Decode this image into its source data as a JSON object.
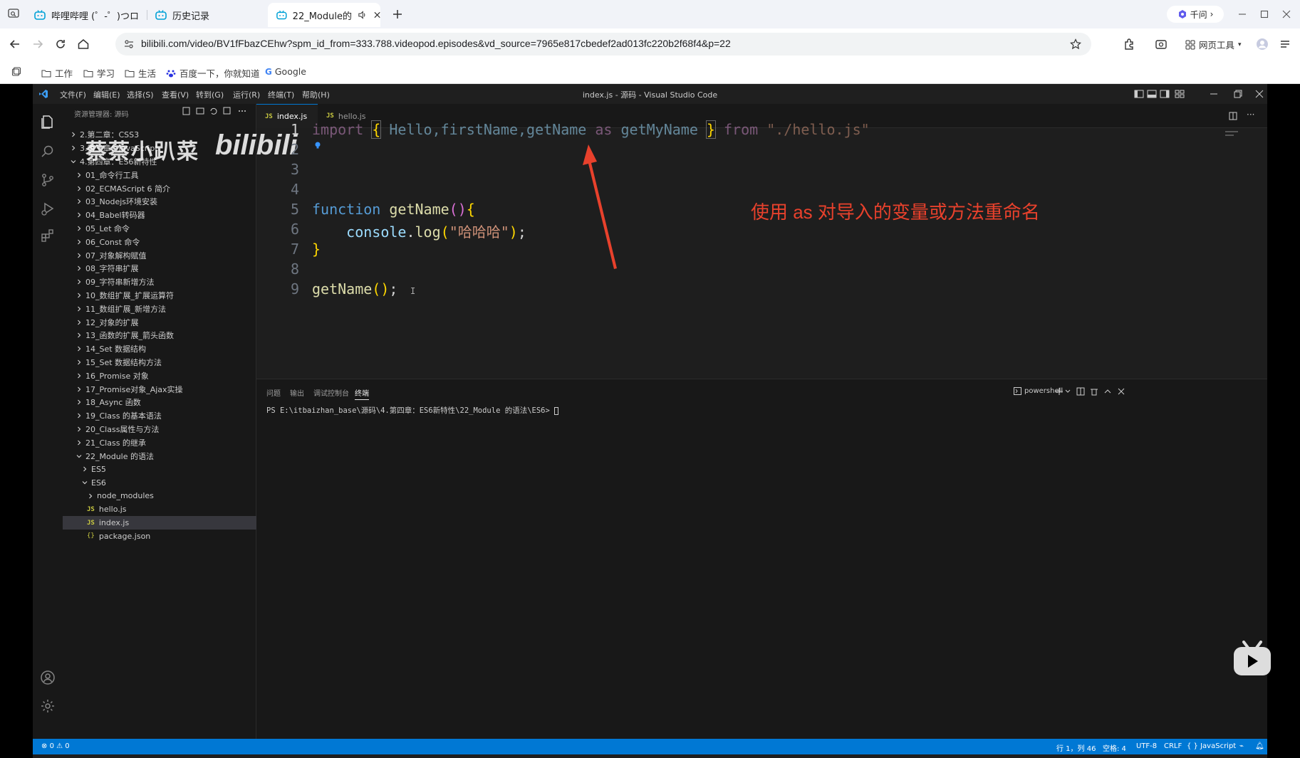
{
  "browser": {
    "tabs": [
      {
        "label": "哔哩哔哩 (゜-゜)つロ"
      },
      {
        "label": "历史记录"
      },
      {
        "label": "22_Module的"
      }
    ],
    "qianwen_label": "千问",
    "url": "bilibili.com/video/BV1fFbazCEhw?spm_id_from=333.788.videopod.episodes&vd_source=7965e817cbedef2ad013fc220b2f68f4&p=22",
    "web_tools_label": "网页工具",
    "bookmarks": [
      "工作",
      "学习",
      "生活",
      "百度一下，你就知道",
      "Google"
    ]
  },
  "vscode": {
    "menus": [
      "文件(F)",
      "编辑(E)",
      "选择(S)",
      "查看(V)",
      "转到(G)",
      "运行(R)",
      "终端(T)",
      "帮助(H)"
    ],
    "window_title": "index.js - 源码 - Visual Studio Code",
    "explorer_header": "资源管理器: 源码",
    "watermark": "蔡蔡小趴菜",
    "watermark_logo": "bilibili",
    "tree": [
      {
        "label": "2.第二章：CSS3",
        "indent": 1,
        "type": "folder",
        "open": false
      },
      {
        "label": "3.第三章：JavaScript",
        "indent": 1,
        "type": "folder",
        "open": false
      },
      {
        "label": "4.第四章：ES6新特性",
        "indent": 1,
        "type": "folder",
        "open": true
      },
      {
        "label": "01_命令行工具",
        "indent": 2,
        "type": "folder",
        "open": false
      },
      {
        "label": "02_ECMAScript 6 简介",
        "indent": 2,
        "type": "folder",
        "open": false
      },
      {
        "label": "03_Nodejs环境安装",
        "indent": 2,
        "type": "folder",
        "open": false
      },
      {
        "label": "04_Babel转码器",
        "indent": 2,
        "type": "folder",
        "open": false
      },
      {
        "label": "05_Let 命令",
        "indent": 2,
        "type": "folder",
        "open": false
      },
      {
        "label": "06_Const 命令",
        "indent": 2,
        "type": "folder",
        "open": false
      },
      {
        "label": "07_对象解构赋值",
        "indent": 2,
        "type": "folder",
        "open": false
      },
      {
        "label": "08_字符串扩展",
        "indent": 2,
        "type": "folder",
        "open": false
      },
      {
        "label": "09_字符串新增方法",
        "indent": 2,
        "type": "folder",
        "open": false
      },
      {
        "label": "10_数组扩展_扩展运算符",
        "indent": 2,
        "type": "folder",
        "open": false
      },
      {
        "label": "11_数组扩展_新增方法",
        "indent": 2,
        "type": "folder",
        "open": false
      },
      {
        "label": "12_对象的扩展",
        "indent": 2,
        "type": "folder",
        "open": false
      },
      {
        "label": "13_函数的扩展_箭头函数",
        "indent": 2,
        "type": "folder",
        "open": false
      },
      {
        "label": "14_Set 数据结构",
        "indent": 2,
        "type": "folder",
        "open": false
      },
      {
        "label": "15_Set 数据结构方法",
        "indent": 2,
        "type": "folder",
        "open": false
      },
      {
        "label": "16_Promise 对象",
        "indent": 2,
        "type": "folder",
        "open": false
      },
      {
        "label": "17_Promise对象_Ajax实操",
        "indent": 2,
        "type": "folder",
        "open": false
      },
      {
        "label": "18_Async 函数",
        "indent": 2,
        "type": "folder",
        "open": false
      },
      {
        "label": "19_Class 的基本语法",
        "indent": 2,
        "type": "folder",
        "open": false
      },
      {
        "label": "20_Class属性与方法",
        "indent": 2,
        "type": "folder",
        "open": false
      },
      {
        "label": "21_Class 的继承",
        "indent": 2,
        "type": "folder",
        "open": false
      },
      {
        "label": "22_Module 的语法",
        "indent": 2,
        "type": "folder",
        "open": true
      },
      {
        "label": "ES5",
        "indent": 3,
        "type": "folder",
        "open": false
      },
      {
        "label": "ES6",
        "indent": 3,
        "type": "folder",
        "open": true
      },
      {
        "label": "node_modules",
        "indent": 4,
        "type": "folder",
        "open": false
      },
      {
        "label": "hello.js",
        "indent": 4,
        "type": "js"
      },
      {
        "label": "index.js",
        "indent": 4,
        "type": "js",
        "selected": true
      },
      {
        "label": "package.json",
        "indent": 4,
        "type": "json"
      }
    ],
    "editor_tabs": [
      {
        "label": "index.js",
        "active": true
      },
      {
        "label": "hello.js",
        "active": false
      }
    ],
    "line_numbers": [
      "1",
      "2",
      "3",
      "4",
      "5",
      "6",
      "7",
      "8",
      "9"
    ],
    "code": {
      "l1": {
        "import": "import",
        "lb": "{",
        "names": " Hello,firstName,getName ",
        "as": "as",
        "alias": " getMyName ",
        "rb": "}",
        "from": " from ",
        "path": "\"./hello.js\""
      },
      "l5": {
        "kw": "function",
        "name": "getName",
        "paren": "()",
        "brace": "{"
      },
      "l6": {
        "obj": "console",
        "dot": ".",
        "method": "log",
        "lp": "(",
        "str": "\"哈哈哈\"",
        "rp": ")",
        "semi": ";"
      },
      "l7": {
        "brace": "}"
      },
      "l9": {
        "name": "getName",
        "paren": "()",
        "semi": ";"
      }
    },
    "annotation": "使用 as 对导入的变量或方法重命名",
    "panel_tabs": [
      "问题",
      "输出",
      "调试控制台",
      "终端"
    ],
    "shell_label": "powershell",
    "terminal_line": "PS E:\\itbaizhan_base\\源码\\4.第四章：ES6新特性\\22_Module 的语法\\ES6> ",
    "status": {
      "errors": "0",
      "warnings": "0",
      "position": "行 1，列 46",
      "spaces": "空格: 4",
      "encoding": "UTF-8",
      "eol": "CRLF",
      "language": "JavaScript"
    }
  },
  "colors": {
    "accent": "#0078d4",
    "annotation": "#e8412c",
    "keyword": "#569cd6",
    "function": "#dcdcaa",
    "string": "#ce9178"
  }
}
